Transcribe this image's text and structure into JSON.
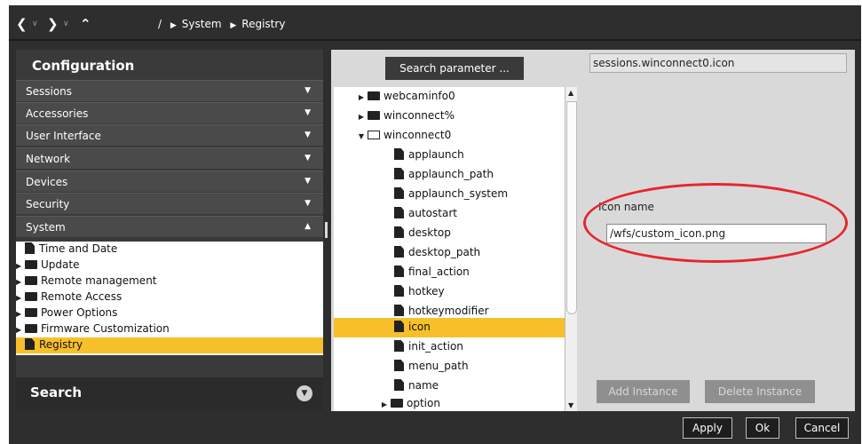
{
  "nav": {
    "back_icon": "chevron-left-icon",
    "forward_icon": "chevron-right-icon",
    "up_icon": "chevron-up-icon",
    "root_sep": "/",
    "breadcrumb": [
      "System",
      "Registry"
    ]
  },
  "sidebar": {
    "title": "Configuration",
    "sections": [
      {
        "label": "Sessions"
      },
      {
        "label": "Accessories"
      },
      {
        "label": "User Interface"
      },
      {
        "label": "Network"
      },
      {
        "label": "Devices"
      },
      {
        "label": "Security"
      },
      {
        "label": "System"
      }
    ],
    "system_items": [
      {
        "label": "Time and Date",
        "type": "file"
      },
      {
        "label": "Update",
        "type": "folder"
      },
      {
        "label": "Remote management",
        "type": "folder"
      },
      {
        "label": "Remote Access",
        "type": "folder"
      },
      {
        "label": "Power Options",
        "type": "folder"
      },
      {
        "label": "Firmware Customization",
        "type": "folder"
      },
      {
        "label": "Registry",
        "type": "file",
        "selected": true
      }
    ],
    "search_title": "Search"
  },
  "registry": {
    "search_button": "Search parameter ...",
    "param_path": "sessions.winconnect0.icon",
    "tree": [
      {
        "label": "webcaminfo0",
        "type": "folder"
      },
      {
        "label": "winconnect%",
        "type": "folder"
      },
      {
        "label": "winconnect0",
        "type": "folder-open"
      },
      {
        "label": "applaunch",
        "type": "file"
      },
      {
        "label": "applaunch_path",
        "type": "file"
      },
      {
        "label": "applaunch_system",
        "type": "file"
      },
      {
        "label": "autostart",
        "type": "file"
      },
      {
        "label": "desktop",
        "type": "file"
      },
      {
        "label": "desktop_path",
        "type": "file"
      },
      {
        "label": "final_action",
        "type": "file"
      },
      {
        "label": "hotkey",
        "type": "file"
      },
      {
        "label": "hotkeymodifier",
        "type": "file"
      },
      {
        "label": "icon",
        "type": "file",
        "selected": true
      },
      {
        "label": "init_action",
        "type": "file"
      },
      {
        "label": "menu_path",
        "type": "file"
      },
      {
        "label": "name",
        "type": "file"
      },
      {
        "label": "option",
        "type": "folder"
      }
    ],
    "field_label": "Icon name",
    "field_value": "/wfs/custom_icon.png",
    "add_instance": "Add Instance",
    "delete_instance": "Delete Instance"
  },
  "footer": {
    "apply": "Apply",
    "ok": "Ok",
    "cancel": "Cancel"
  },
  "colors": {
    "selection": "#f7c02a",
    "highlight_ring": "#e6262e"
  }
}
